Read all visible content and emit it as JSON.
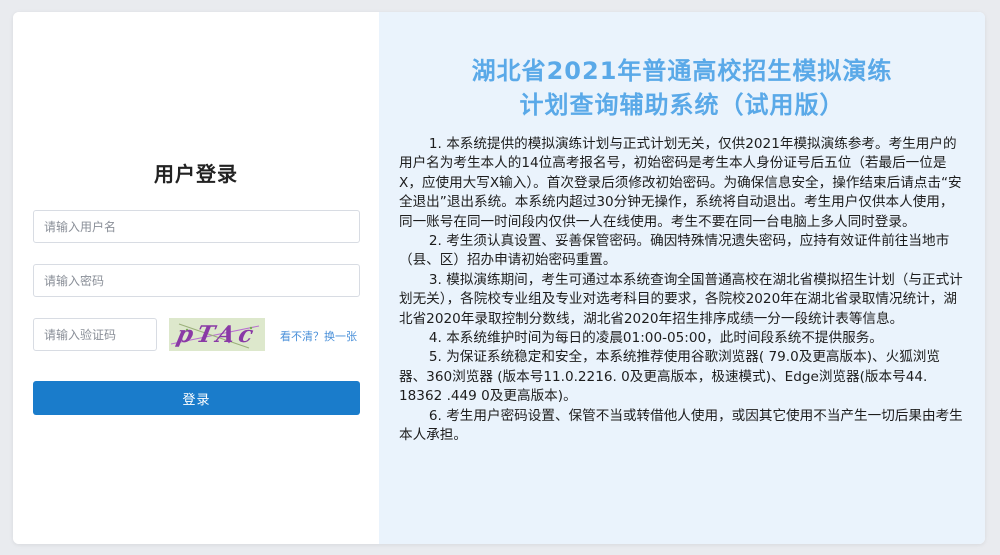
{
  "login": {
    "title": "用户登录",
    "username_placeholder": "请输入用户名",
    "password_placeholder": "请输入密码",
    "captcha_placeholder": "请输入验证码",
    "captcha_text": "pTAc",
    "refresh_label": "看不清？换一张",
    "submit_label": "登录"
  },
  "info": {
    "title_line1": "湖北省2021年普通高校招生模拟演练",
    "title_line2": "计划查询辅助系统（试用版）",
    "paragraphs": [
      "1. 本系统提供的模拟演练计划与正式计划无关，仅供2021年模拟演练参考。考生用户的用户名为考生本人的14位高考报名号，初始密码是考生本人身份证号后五位（若最后一位是X，应使用大写X输入）。首次登录后须修改初始密码。为确保信息安全，操作结束后请点击“安全退出”退出系统。本系统内超过30分钟无操作，系统将自动退出。考生用户仅供本人使用，同一账号在同一时间段内仅供一人在线使用。考生不要在同一台电脑上多人同时登录。",
      "2. 考生须认真设置、妥善保管密码。确因特殊情况遗失密码，应持有效证件前往当地市（县、区）招办申请初始密码重置。",
      "3. 模拟演练期间，考生可通过本系统查询全国普通高校在湖北省模拟招生计划（与正式计划无关），各院校专业组及专业对选考科目的要求，各院校2020年在湖北省录取情况统计，湖北省2020年录取控制分数线，湖北省2020年招生排序成绩一分一段统计表等信息。",
      "4. 本系统维护时间为每日的凌晨01:00-05:00，此时间段系统不提供服务。",
      "5. 为保证系统稳定和安全，本系统推荐使用谷歌浏览器( 79.0及更高版本)、火狐浏览器、360浏览器 (版本号11.0.2216. 0及更高版本，极速模式)、Edge浏览器(版本号44. 18362 .449 0及更高版本)。",
      "6. 考生用户密码设置、保管不当或转借他人使用，或因其它使用不当产生一切后果由考生本人承担。"
    ]
  },
  "colors": {
    "accent": "#1a7ccb",
    "title_blue": "#5aa9e8",
    "panel_bg": "#eaf3fc",
    "page_bg": "#e9ebef"
  }
}
